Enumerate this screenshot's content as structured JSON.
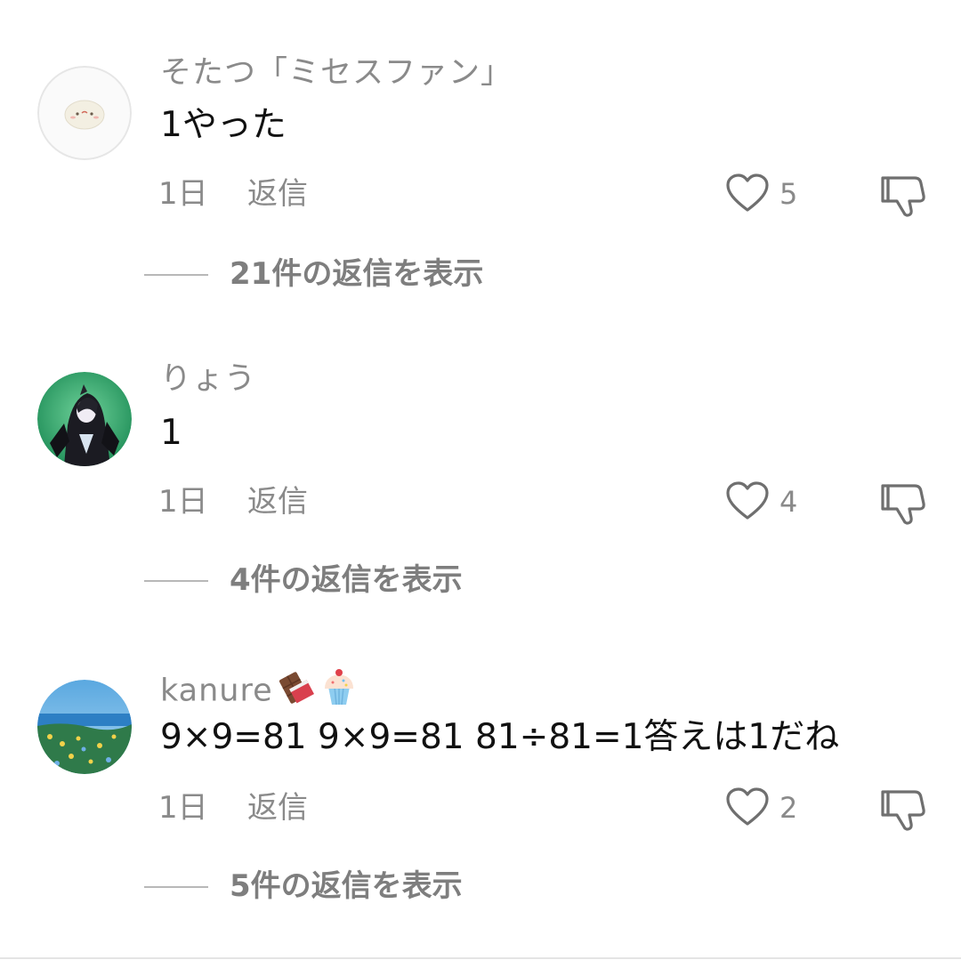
{
  "comments": [
    {
      "username": "そたつ「ミセスファン」",
      "text": "1やった",
      "time": "1日",
      "reply_label": "返信",
      "likes": "5",
      "view_replies": "21件の返信を表示",
      "avatar_icon": "white-blob-avatar"
    },
    {
      "username": "りょう",
      "text": "1",
      "time": "1日",
      "reply_label": "返信",
      "likes": "4",
      "view_replies": "4件の返信を表示",
      "avatar_icon": "anime-character-avatar"
    },
    {
      "username": "kanure",
      "username_emoji": [
        "chocolate-bar-emoji",
        "cupcake-emoji"
      ],
      "text": "9×9=81 9×9=81 81÷81=1答えは1だね",
      "time": "1日",
      "reply_label": "返信",
      "likes": "2",
      "view_replies": "5件の返信を表示",
      "avatar_icon": "seaside-flowers-avatar"
    }
  ],
  "icons": {
    "like": "heart-icon",
    "dislike": "thumbs-down-icon"
  },
  "colors": {
    "secondary_text": "#8a8a8a",
    "primary_text": "#111111",
    "icon_stroke": "#6f6f6f"
  }
}
